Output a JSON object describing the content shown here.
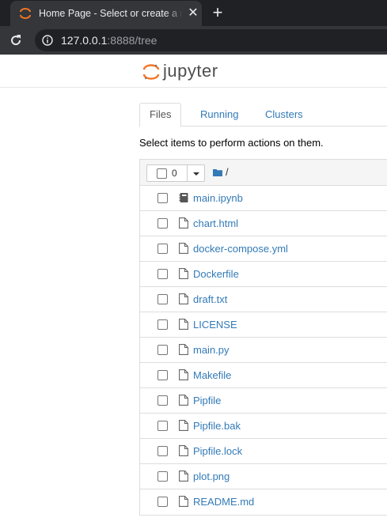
{
  "browser": {
    "tab_title": "Home Page - Select or create a notebook",
    "close_glyph": "✕",
    "new_tab_glyph": "+",
    "url_host": "127.0.0.1",
    "url_rest": ":8888/tree"
  },
  "header": {
    "logo_text": "jupyter"
  },
  "tabs": [
    {
      "label": "Files",
      "active": true
    },
    {
      "label": "Running",
      "active": false
    },
    {
      "label": "Clusters",
      "active": false
    }
  ],
  "instructions": "Select items to perform actions on them.",
  "toolbar": {
    "selected_count": "0",
    "breadcrumb_sep": "/"
  },
  "files": [
    {
      "name": "main.ipynb",
      "icon": "notebook-icon"
    },
    {
      "name": "chart.html",
      "icon": "file-icon"
    },
    {
      "name": "docker-compose.yml",
      "icon": "file-icon"
    },
    {
      "name": "Dockerfile",
      "icon": "file-icon"
    },
    {
      "name": "draft.txt",
      "icon": "file-icon"
    },
    {
      "name": "LICENSE",
      "icon": "file-icon"
    },
    {
      "name": "main.py",
      "icon": "file-icon"
    },
    {
      "name": "Makefile",
      "icon": "file-icon"
    },
    {
      "name": "Pipfile",
      "icon": "file-icon"
    },
    {
      "name": "Pipfile.bak",
      "icon": "file-icon"
    },
    {
      "name": "Pipfile.lock",
      "icon": "file-icon"
    },
    {
      "name": "plot.png",
      "icon": "file-icon"
    },
    {
      "name": "README.md",
      "icon": "file-icon"
    }
  ],
  "colors": {
    "link": "#337ab7",
    "jupyter_orange": "#f37726",
    "tab_bar": "#202124",
    "tab_active": "#35363a"
  }
}
